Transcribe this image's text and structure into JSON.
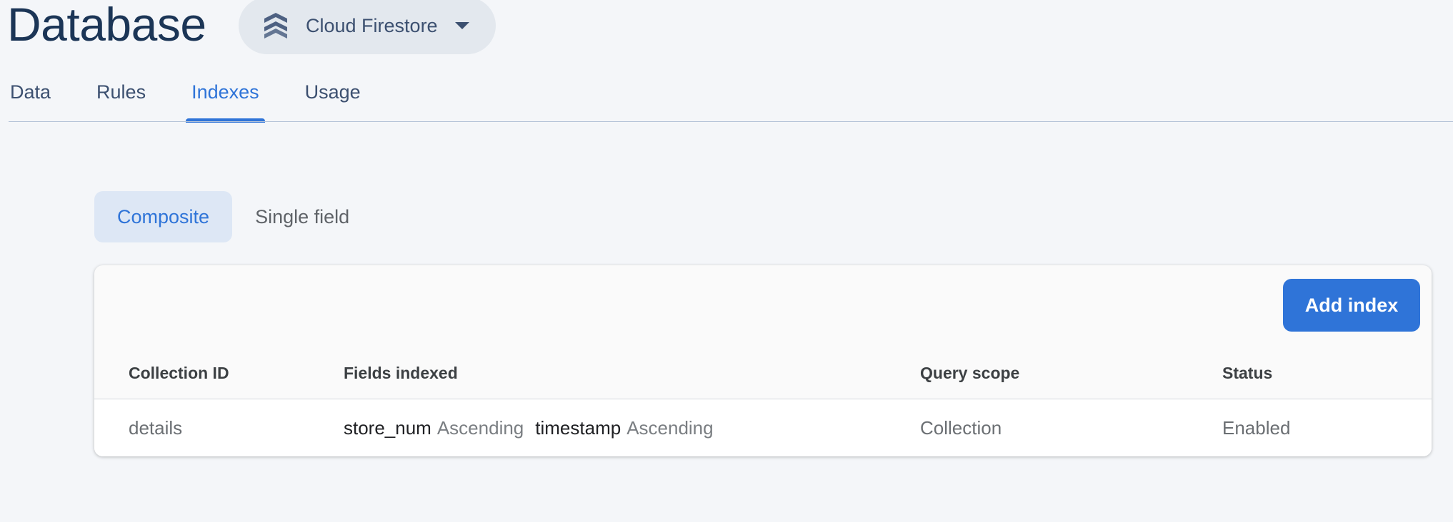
{
  "page": {
    "title": "Database"
  },
  "product_selector": {
    "label": "Cloud Firestore",
    "icon": "firestore-icon"
  },
  "tabs": [
    {
      "label": "Data",
      "active": false
    },
    {
      "label": "Rules",
      "active": false
    },
    {
      "label": "Indexes",
      "active": true
    },
    {
      "label": "Usage",
      "active": false
    }
  ],
  "subtabs": [
    {
      "label": "Composite",
      "active": true
    },
    {
      "label": "Single field",
      "active": false
    }
  ],
  "toolbar": {
    "add_index_label": "Add index"
  },
  "table": {
    "columns": [
      "Collection ID",
      "Fields indexed",
      "Query scope",
      "Status"
    ],
    "rows": [
      {
        "collection_id": "details",
        "fields": [
          {
            "name": "store_num",
            "order": "Ascending"
          },
          {
            "name": "timestamp",
            "order": "Ascending"
          }
        ],
        "query_scope": "Collection",
        "status": "Enabled"
      }
    ]
  },
  "colors": {
    "accent": "#2f74d8",
    "background": "#f4f6f9",
    "title": "#1b3556",
    "selector_bg": "#e3e8ee",
    "chip_active_bg": "#dde7f5"
  }
}
